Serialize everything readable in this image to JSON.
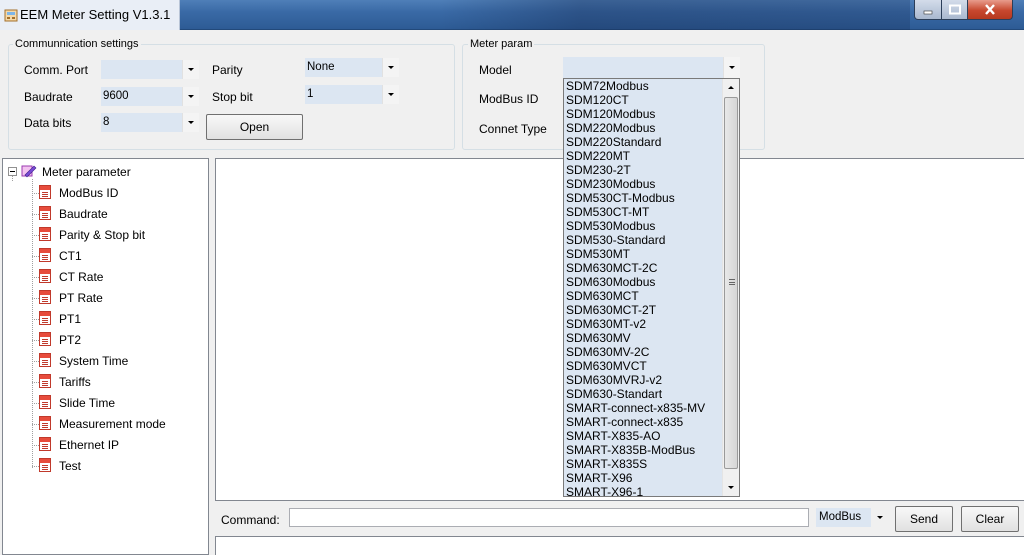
{
  "window": {
    "title": "EEM Meter Setting V1.3.1",
    "controls": {
      "minimize_icon": "minimize-icon",
      "maximize_icon": "maximize-icon",
      "close_icon": "close-icon"
    }
  },
  "comm_settings": {
    "title": "Communnication settings",
    "comm_port": {
      "label": "Comm. Port",
      "value": ""
    },
    "baudrate": {
      "label": "Baudrate",
      "value": "9600"
    },
    "data_bits": {
      "label": "Data bits",
      "value": "8"
    },
    "parity": {
      "label": "Parity",
      "value": "None"
    },
    "stop_bit": {
      "label": "Stop bit",
      "value": "1"
    },
    "open_button": "Open"
  },
  "meter_param": {
    "title": "Meter param",
    "model": {
      "label": "Model",
      "value": ""
    },
    "modbus_id": {
      "label": "ModBus ID"
    },
    "connect_type": {
      "label": "Connet Type"
    }
  },
  "model_options": [
    "SDM72Modbus",
    "SDM120CT",
    "SDM120Modbus",
    "SDM220Modbus",
    "SDM220Standard",
    "SDM220MT",
    "SDM230-2T",
    "SDM230Modbus",
    "SDM530CT-Modbus",
    "SDM530CT-MT",
    "SDM530Modbus",
    "SDM530-Standard",
    "SDM530MT",
    "SDM630MCT-2C",
    "SDM630Modbus",
    "SDM630MCT",
    "SDM630MCT-2T",
    "SDM630MT-v2",
    "SDM630MV",
    "SDM630MV-2C",
    "SDM630MVCT",
    "SDM630MVRJ-v2",
    "SDM630-Standart",
    "SMART-connect-x835-MV",
    "SMART-connect-x835",
    "SMART-X835-AO",
    "SMART-X835B-ModBus",
    "SMART-X835S",
    "SMART-X96",
    "SMART-X96-1"
  ],
  "tree": {
    "root": "Meter parameter",
    "items": [
      "ModBus ID",
      "Baudrate",
      "Parity & Stop bit",
      "CT1",
      "CT Rate",
      "PT Rate",
      "PT1",
      "PT2",
      "System Time",
      "Tariffs",
      "Slide Time",
      "Measurement mode",
      "Ethernet IP",
      "Test"
    ]
  },
  "command_bar": {
    "label": "Command:",
    "input_value": "",
    "protocol": "ModBus",
    "send_button": "Send",
    "clear_button": "Clear"
  },
  "colors": {
    "combo_bg": "#dce6f2",
    "titlebar": "#3a6aa6",
    "close_button": "#c7482f"
  }
}
